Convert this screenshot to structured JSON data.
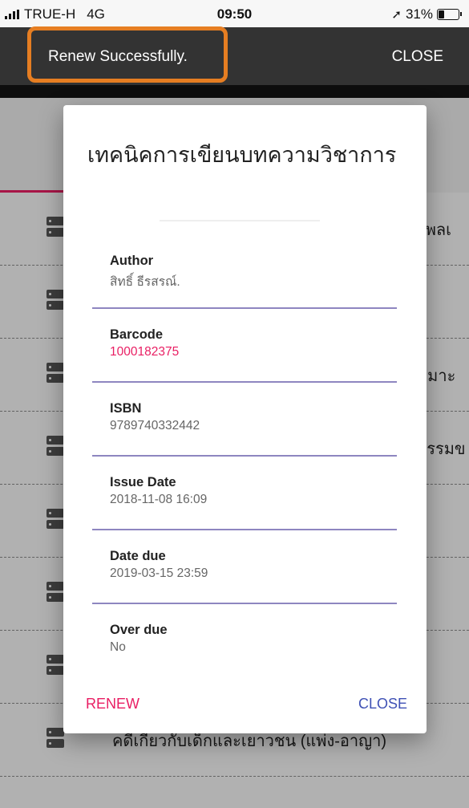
{
  "status_bar": {
    "carrier": "TRUE-H",
    "network": "4G",
    "time": "09:50",
    "battery_text": "31%",
    "battery_level": 0.31
  },
  "snackbar": {
    "message": "Renew Successfully.",
    "action": "CLOSE",
    "highlight_color": "#e67e22"
  },
  "background_list": {
    "visible_text": [
      "ริพลเ",
      "",
      "หมาะ",
      "ธรรมข",
      "",
      "",
      "",
      "คดีเกี่ยวกับเด็กและเยาวชน (แพ่ง-อาญา)"
    ],
    "accent_color": "#e91e63"
  },
  "dialog": {
    "title": "เทคนิคการเขียนบทความวิชาการ",
    "fields": [
      {
        "label": "Author",
        "value": "สิทธิ์ ธีรสรณ์.",
        "color": "#666666"
      },
      {
        "label": "Barcode",
        "value": "1000182375",
        "color": "#e91e63"
      },
      {
        "label": "ISBN",
        "value": "9789740332442",
        "color": "#666666"
      },
      {
        "label": "Issue Date",
        "value": "2018-11-08 16:09",
        "color": "#666666"
      },
      {
        "label": "Date due",
        "value": "2019-03-15 23:59",
        "color": "#666666"
      },
      {
        "label": "Over due",
        "value": "No",
        "color": "#666666"
      }
    ],
    "buttons": {
      "renew": "RENEW",
      "close": "CLOSE"
    },
    "colors": {
      "renew": "#e91e63",
      "close": "#3f51b5",
      "divider": "#8e86c0"
    }
  }
}
